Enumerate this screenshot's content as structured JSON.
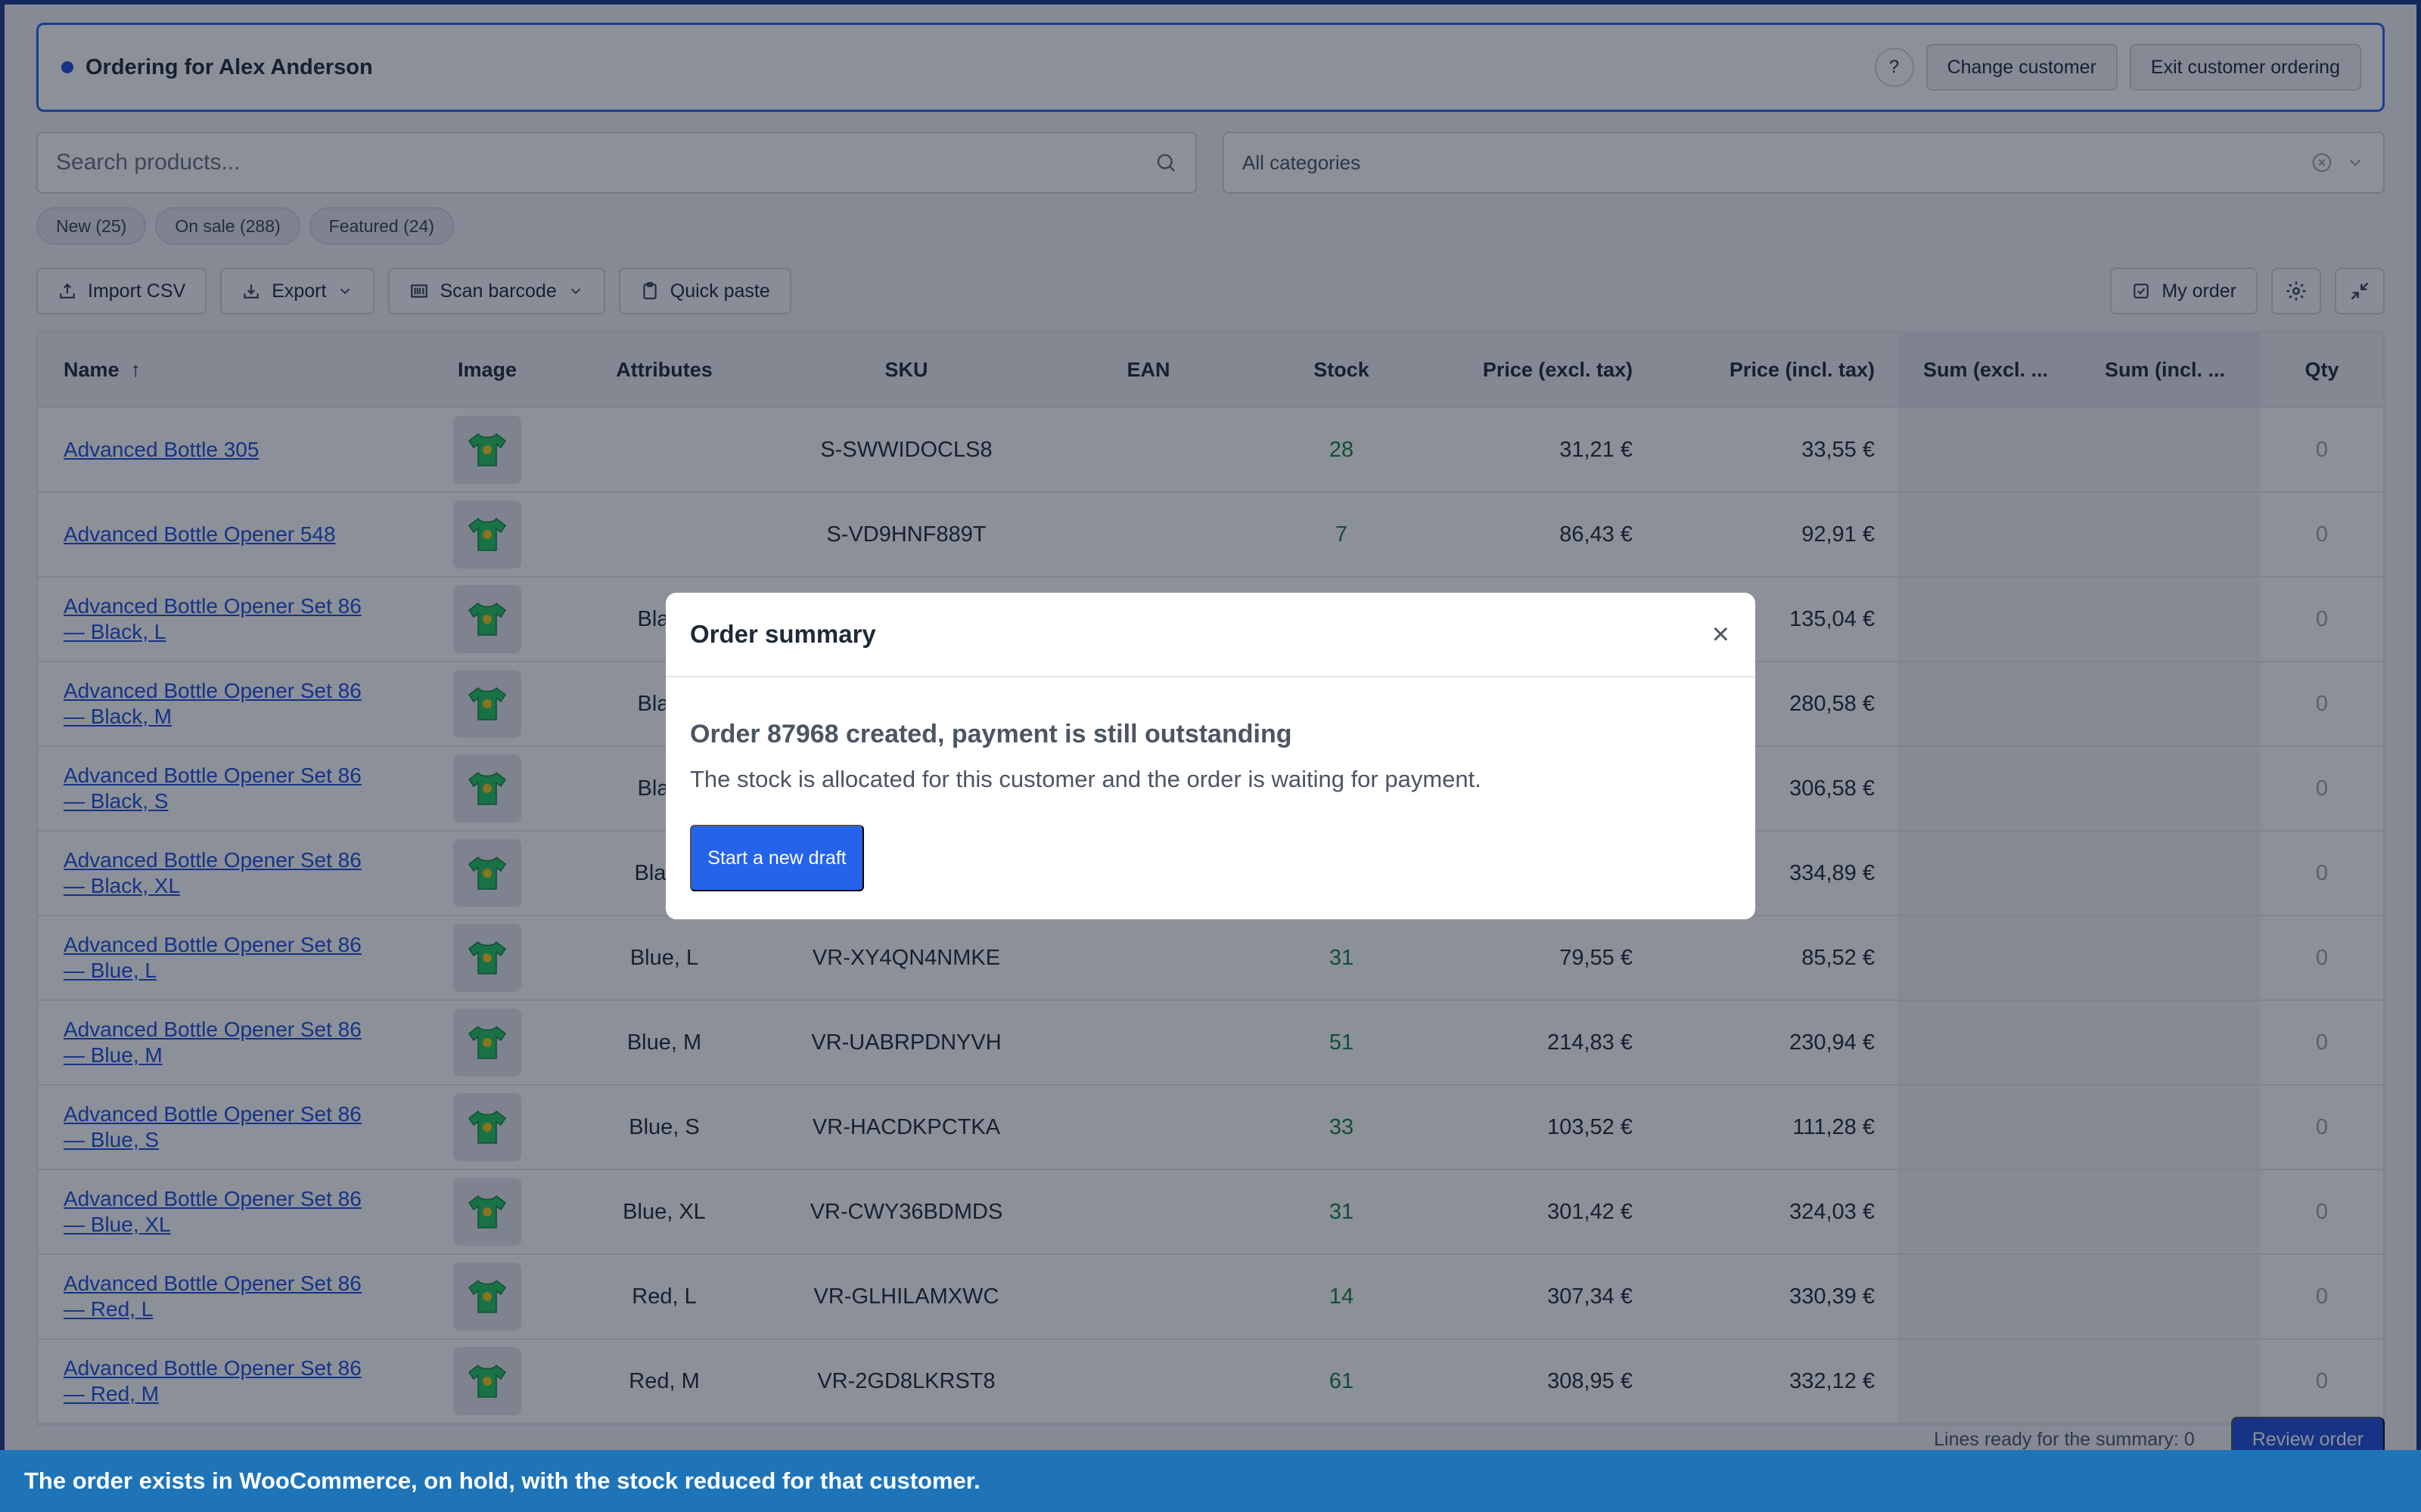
{
  "banner": {
    "title": "Ordering for Alex Anderson",
    "help_label": "?",
    "change_customer": "Change customer",
    "exit_customer_ordering": "Exit customer ordering"
  },
  "search": {
    "placeholder": "Search products..."
  },
  "category": {
    "selected": "All categories"
  },
  "chips": [
    "New (25)",
    "On sale (288)",
    "Featured (24)"
  ],
  "toolbar": {
    "import_csv": "Import CSV",
    "export": "Export",
    "scan_barcode": "Scan barcode",
    "quick_paste": "Quick paste",
    "my_order": "My order"
  },
  "table": {
    "headers": {
      "name": "Name",
      "image": "Image",
      "attributes": "Attributes",
      "sku": "SKU",
      "ean": "EAN",
      "stock": "Stock",
      "price_excl": "Price (excl. tax)",
      "price_incl": "Price (incl. tax)",
      "sum_excl": "Sum (excl. ...",
      "sum_incl": "Sum (incl. ...",
      "qty": "Qty"
    },
    "rows": [
      {
        "name": "Advanced Bottle 305",
        "attributes": "",
        "sku": "S-SWWIDOCLS8",
        "stock": "28",
        "price_excl": "31,21 €",
        "price_incl": "33,55 €",
        "qty": "0"
      },
      {
        "name": "Advanced Bottle Opener 548",
        "attributes": "",
        "sku": "S-VD9HNF889T",
        "stock": "7",
        "price_excl": "86,43 €",
        "price_incl": "92,91 €",
        "qty": "0"
      },
      {
        "name": "Advanced Bottle Opener Set 86",
        "variant": "— Black, L",
        "attributes": "Black",
        "sku": "",
        "stock": "",
        "price_excl": "",
        "price_incl": "135,04 €",
        "qty": "0"
      },
      {
        "name": "Advanced Bottle Opener Set 86",
        "variant": "— Black, M",
        "attributes": "Black",
        "sku": "",
        "stock": "",
        "price_excl": "",
        "price_incl": "280,58 €",
        "qty": "0"
      },
      {
        "name": "Advanced Bottle Opener Set 86",
        "variant": "— Black, S",
        "attributes": "Black",
        "sku": "",
        "stock": "",
        "price_excl": "",
        "price_incl": "306,58 €",
        "qty": "0"
      },
      {
        "name": "Advanced Bottle Opener Set 86",
        "variant": "— Black, XL",
        "attributes": "Black,",
        "sku": "",
        "stock": "",
        "price_excl": "",
        "price_incl": "334,89 €",
        "qty": "0"
      },
      {
        "name": "Advanced Bottle Opener Set 86",
        "variant": "— Blue, L",
        "attributes": "Blue, L",
        "sku": "VR-XY4QN4NMKE",
        "stock": "31",
        "price_excl": "79,55 €",
        "price_incl": "85,52 €",
        "qty": "0"
      },
      {
        "name": "Advanced Bottle Opener Set 86",
        "variant": "— Blue, M",
        "attributes": "Blue, M",
        "sku": "VR-UABRPDNYVH",
        "stock": "51",
        "price_excl": "214,83 €",
        "price_incl": "230,94 €",
        "qty": "0"
      },
      {
        "name": "Advanced Bottle Opener Set 86",
        "variant": "— Blue, S",
        "attributes": "Blue, S",
        "sku": "VR-HACDKPCTKA",
        "stock": "33",
        "price_excl": "103,52 €",
        "price_incl": "111,28 €",
        "qty": "0"
      },
      {
        "name": "Advanced Bottle Opener Set 86",
        "variant": "— Blue, XL",
        "attributes": "Blue, XL",
        "sku": "VR-CWY36BDMDS",
        "stock": "31",
        "price_excl": "301,42 €",
        "price_incl": "324,03 €",
        "qty": "0"
      },
      {
        "name": "Advanced Bottle Opener Set 86",
        "variant": "— Red, L",
        "attributes": "Red, L",
        "sku": "VR-GLHILAMXWC",
        "stock": "14",
        "price_excl": "307,34 €",
        "price_incl": "330,39 €",
        "qty": "0"
      },
      {
        "name": "Advanced Bottle Opener Set 86",
        "variant": "— Red, M",
        "attributes": "Red, M",
        "sku": "VR-2GD8LKRST8",
        "stock": "61",
        "price_excl": "308,95 €",
        "price_incl": "332,12 €",
        "qty": "0"
      }
    ]
  },
  "footer": {
    "lines_ready": "Lines ready for the summary: 0",
    "review_order": "Review order"
  },
  "modal": {
    "title": "Order summary",
    "close": "×",
    "heading": "Order 87968 created, payment is still outstanding",
    "text": "The stock is allocated for this customer and the order is waiting for payment.",
    "primary": "Start a new draft"
  },
  "caption": "The order exists in WooCommerce, on hold, with the stock reduced for that customer.",
  "colors": {
    "accent": "#2563eb",
    "stock_green": "#15803d",
    "caption_bg": "#1f74b8"
  }
}
